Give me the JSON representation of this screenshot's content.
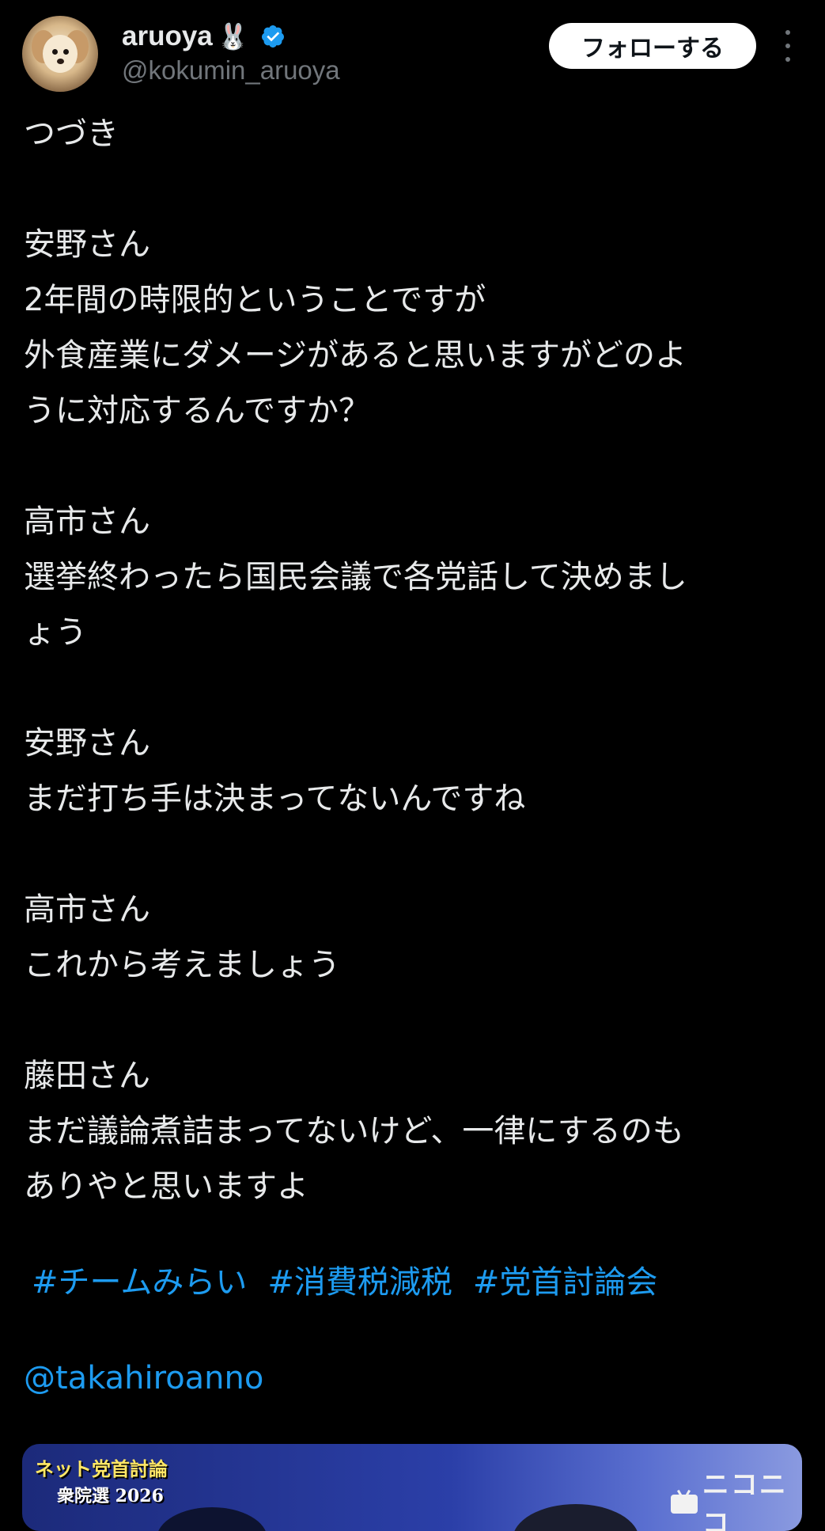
{
  "author": {
    "display_name": "aruoya",
    "name_emoji": "🐰",
    "handle": "@kokumin_aruoya",
    "verified": true,
    "verified_color": "#1d9bf0"
  },
  "actions": {
    "follow_label": "フォローする",
    "more_icon": "more-vertical-icon"
  },
  "tweet": {
    "text": "つづき\n\n安野さん\n2年間の時限的ということですが\n外食産業にダメージがあると思いますがどのよ\nうに対応するんですか？\n\n高市さん\n選挙終わったら国民会議で各党話して決めまし\nょう\n\n安野さん\nまだ打ち手は決まってないんですね\n\n高市さん\nこれから考えましょう\n\n藤田さん\nまだ議論煮詰まってないけど、一律にするのも\nありやと思いますよ",
    "hashtags": [
      "#チームみらい",
      "#消費税減税",
      "#党首討論会"
    ],
    "mention": "@takahiroanno",
    "link_color": "#1d9bf0"
  },
  "media": {
    "title": "ネット党首討論",
    "subtitle": "衆院選 2026",
    "logo_text": "ニコニコ",
    "logo_icon": "tv-icon"
  }
}
